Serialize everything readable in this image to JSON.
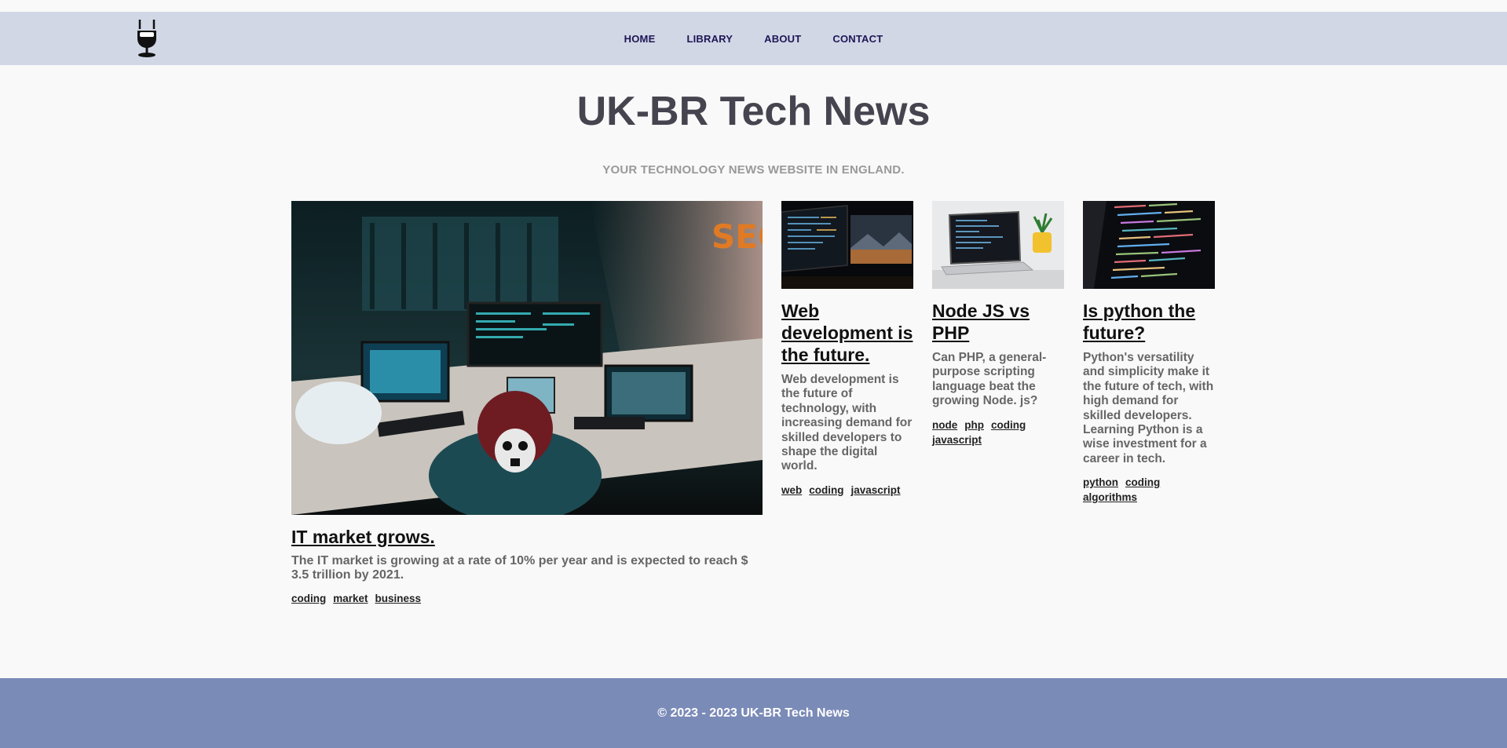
{
  "header": {
    "logo_icon": "microphone-icon",
    "nav": [
      "HOME",
      "LIBRARY",
      "ABOUT",
      "CONTACT"
    ]
  },
  "site": {
    "title": "UK-BR Tech News",
    "tagline": "YOUR TECHNOLOGY NEWS WEBSITE IN ENGLAND."
  },
  "featured": {
    "title": "IT market grows.",
    "summary": "The IT market is growing at a rate of 10% per year and is expected to reach $ 3.5 trillion by 2021.",
    "tags": [
      "coding",
      "market",
      "business"
    ]
  },
  "articles": [
    {
      "title": "Web development is the future.",
      "summary": "Web development is the future of technology, with increasing demand for skilled developers to shape the digital world.",
      "tags": [
        "web",
        "coding",
        "javascript"
      ]
    },
    {
      "title": "Node JS vs PHP",
      "summary": "Can PHP, a general-purpose scripting language beat the growing Node. js?",
      "tags": [
        "node",
        "php",
        "coding",
        "javascript"
      ]
    },
    {
      "title": "Is python the future?",
      "summary": "Python's versatility and simplicity make it the future of tech, with high demand for skilled developers. Learning Python is a wise investment for a career in tech.",
      "tags": [
        "python",
        "coding",
        "algorithms"
      ]
    }
  ],
  "footer": {
    "copyright": "© 2023 - 2023 UK-BR Tech News"
  }
}
